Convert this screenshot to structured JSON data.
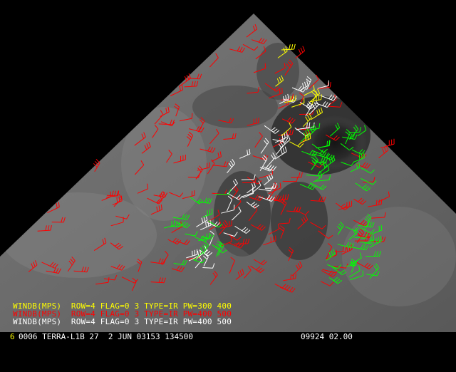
{
  "legend": [
    {
      "text": "WINDB(MPS)  ROW=4 FLAG=0 3 TYPE=IR PW=300 400",
      "color": "#ffff00"
    },
    {
      "text": "WINDB(MPS)  ROW=4 FLAG=0 3 TYPE=IR PW=400 500",
      "color": "#ff0000"
    },
    {
      "text": "WINDB(MPS)  ROW=4 FLAG=0 3 TYPE=IR PW=400 500",
      "color": "#ffffff"
    }
  ],
  "status_bar": {
    "frame_number": "6",
    "frame_color": "#ffff00",
    "text_main": "0006 TERRA-L1B 27  2 JUN 03153 134500",
    "text_right": "09924 02.00",
    "text_color": "#ffffff"
  },
  "colors": {
    "background": "#000000",
    "barb_red": "#ff0000",
    "barb_green": "#00ff00",
    "barb_white": "#ffffff",
    "barb_yellow": "#ffff00"
  }
}
